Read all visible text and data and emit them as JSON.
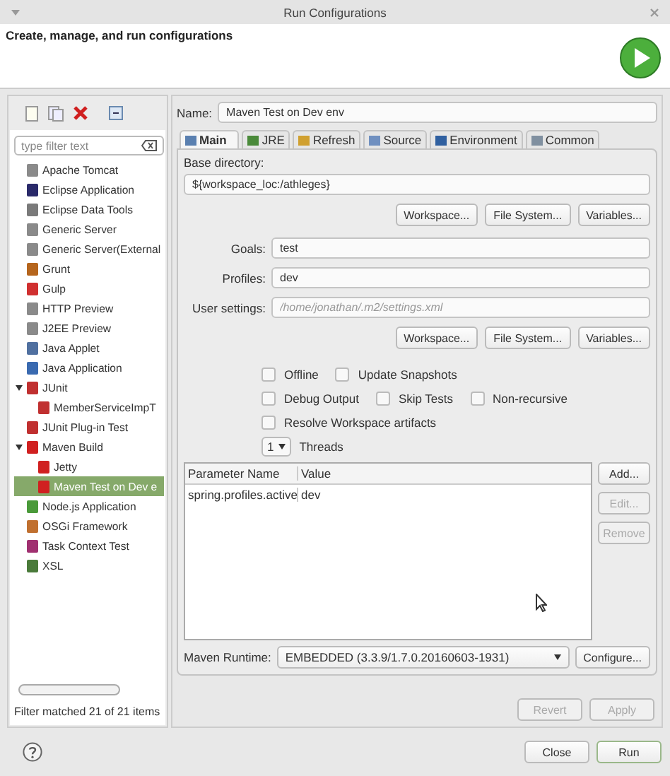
{
  "window": {
    "title": "Run Configurations"
  },
  "header": {
    "title": "Create, manage, and run configurations"
  },
  "filter": {
    "placeholder": "type filter text"
  },
  "tree": [
    {
      "label": "Apache Tomcat",
      "selected": false
    },
    {
      "label": "Eclipse Application",
      "selected": false
    },
    {
      "label": "Eclipse Data Tools",
      "selected": false
    },
    {
      "label": "Generic Server",
      "selected": false
    },
    {
      "label": "Generic Server(External",
      "selected": false
    },
    {
      "label": "Grunt",
      "selected": false
    },
    {
      "label": "Gulp",
      "selected": false
    },
    {
      "label": "HTTP Preview",
      "selected": false
    },
    {
      "label": "J2EE Preview",
      "selected": false
    },
    {
      "label": "Java Applet",
      "selected": false
    },
    {
      "label": "Java Application",
      "selected": false
    },
    {
      "label": "JUnit",
      "selected": false,
      "expanded": true,
      "children": [
        {
          "label": "MemberServiceImpT",
          "selected": false
        }
      ]
    },
    {
      "label": "JUnit Plug-in Test",
      "selected": false
    },
    {
      "label": "Maven Build",
      "selected": false,
      "expanded": true,
      "children": [
        {
          "label": "Jetty",
          "selected": false
        },
        {
          "label": "Maven Test on Dev e",
          "selected": true
        }
      ]
    },
    {
      "label": "Node.js Application",
      "selected": false
    },
    {
      "label": "OSGi Framework",
      "selected": false
    },
    {
      "label": "Task Context Test",
      "selected": false
    },
    {
      "label": "XSL",
      "selected": false
    }
  ],
  "filter_status": "Filter matched 21 of 21 items",
  "name": {
    "label": "Name:",
    "value": "Maven Test on Dev env"
  },
  "tabs": [
    {
      "label": "Main",
      "selected": true
    },
    {
      "label": "JRE",
      "selected": false
    },
    {
      "label": "Refresh",
      "selected": false
    },
    {
      "label": "Source",
      "selected": false
    },
    {
      "label": "Environment",
      "selected": false
    },
    {
      "label": "Common",
      "selected": false
    }
  ],
  "base_directory": {
    "label": "Base directory:",
    "value": "${workspace_loc:/athleges}",
    "buttons": [
      "Workspace...",
      "File System...",
      "Variables..."
    ]
  },
  "goals": {
    "label": "Goals:",
    "value": "test"
  },
  "profiles": {
    "label": "Profiles:",
    "value": "dev"
  },
  "user_settings": {
    "label": "User settings:",
    "placeholder": "/home/jonathan/.m2/settings.xml",
    "buttons": [
      "Workspace...",
      "File System...",
      "Variables..."
    ]
  },
  "options": [
    [
      {
        "label": "Offline",
        "checked": false
      },
      {
        "label": "Update Snapshots",
        "checked": false
      }
    ],
    [
      {
        "label": "Debug Output",
        "checked": false
      },
      {
        "label": "Skip Tests",
        "checked": false
      },
      {
        "label": "Non-recursive",
        "checked": false
      }
    ],
    [
      {
        "label": "Resolve Workspace artifacts",
        "checked": false
      }
    ]
  ],
  "threads": {
    "value": "1",
    "label": "Threads"
  },
  "parameters": {
    "columns": [
      "Parameter Name",
      "Value"
    ],
    "rows": [
      [
        "spring.profiles.active",
        "dev"
      ]
    ],
    "buttons": [
      {
        "label": "Add...",
        "disabled": false
      },
      {
        "label": "Edit...",
        "disabled": true
      },
      {
        "label": "Remove",
        "disabled": true
      }
    ]
  },
  "maven_runtime": {
    "label": "Maven Runtime:",
    "value": "EMBEDDED (3.3.9/1.7.0.20160603-1931)",
    "button": "Configure..."
  },
  "form_buttons": [
    {
      "label": "Revert",
      "disabled": true
    },
    {
      "label": "Apply",
      "disabled": true
    }
  ],
  "dialog_buttons": [
    {
      "label": "Close",
      "default": false
    },
    {
      "label": "Run",
      "default": true
    }
  ]
}
